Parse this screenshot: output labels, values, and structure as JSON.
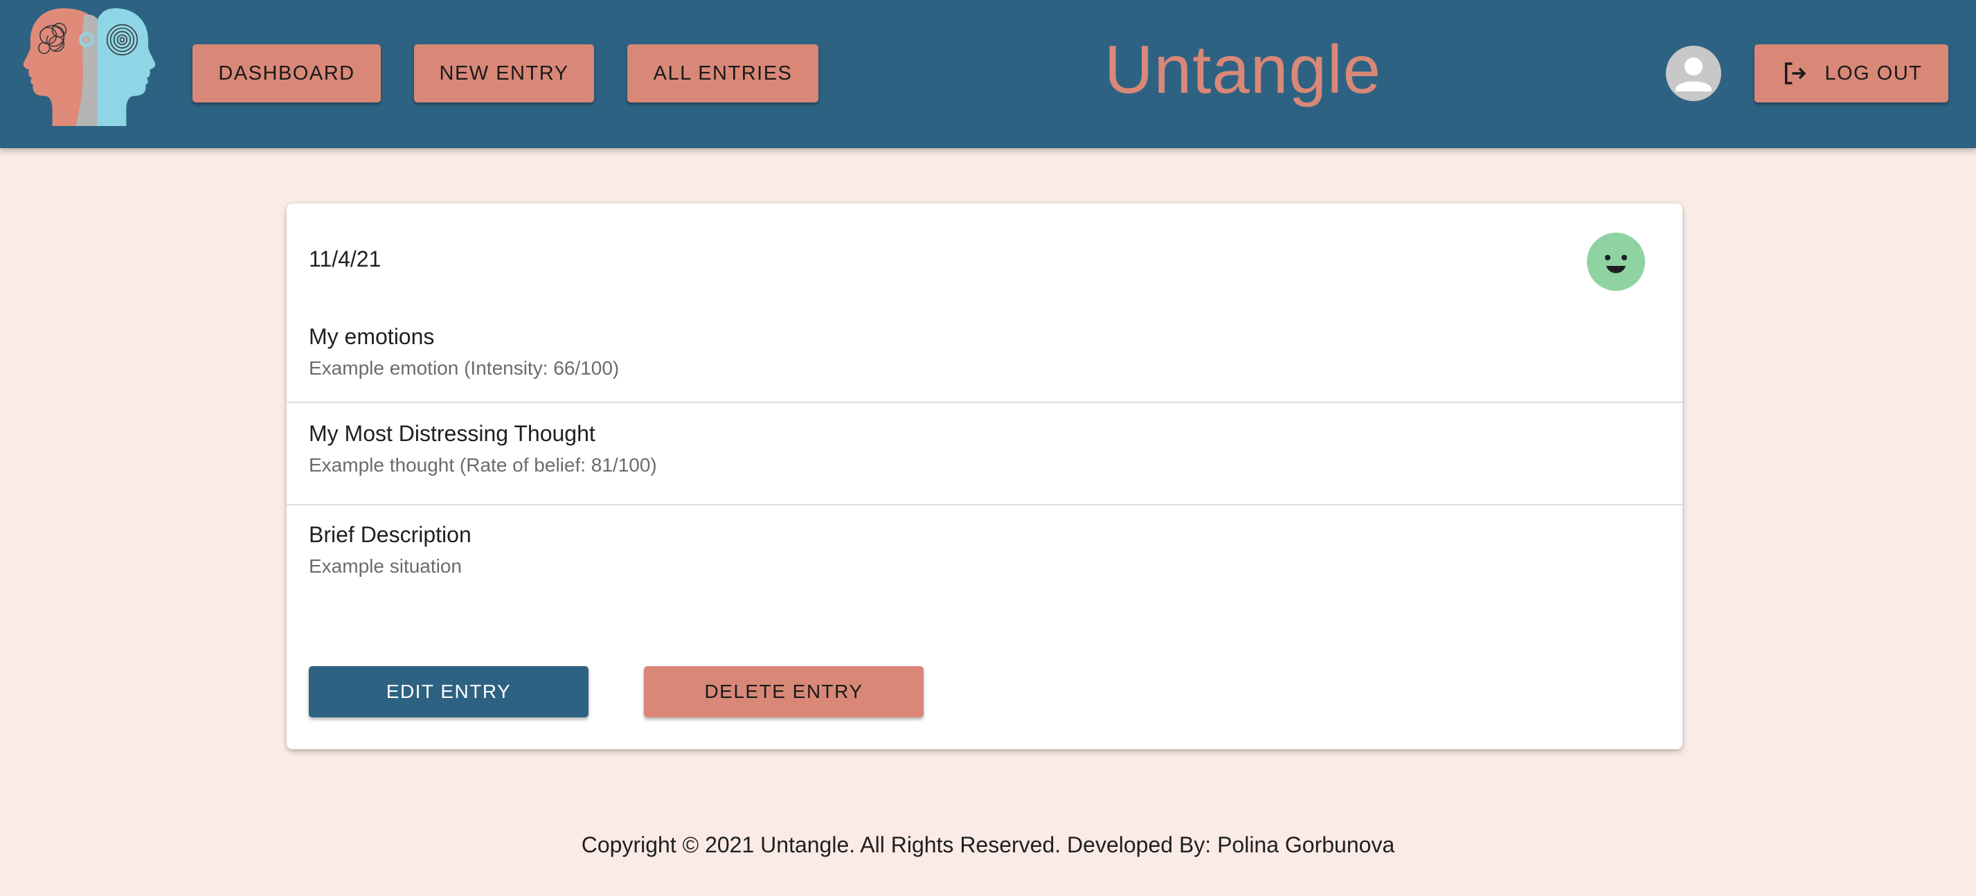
{
  "header": {
    "logo_icon": "two-heads-logo-icon",
    "nav": {
      "dashboard": "DASHBOARD",
      "new_entry": "NEW ENTRY",
      "all_entries": "ALL ENTRIES"
    },
    "title": "Untangle",
    "avatar_icon": "user-avatar-icon",
    "logout_label": "LOG OUT",
    "logout_icon": "logout-icon"
  },
  "entry": {
    "date": "11/4/21",
    "mood_icon": "smiley-face-icon",
    "sections": [
      {
        "title": "My emotions",
        "body": "Example emotion (Intensity: 66/100)"
      },
      {
        "title": "My Most Distressing Thought",
        "body": "Example thought (Rate of belief: 81/100)"
      },
      {
        "title": "Brief Description",
        "body": "Example situation"
      }
    ],
    "edit_label": "EDIT ENTRY",
    "delete_label": "DELETE ENTRY"
  },
  "footer": {
    "text": "Copyright © 2021 Untangle. All Rights Reserved. Developed By: Polina Gorbunova"
  },
  "colors": {
    "header_bg": "#2e6282",
    "accent": "#d98878",
    "page_bg": "#fbebe7",
    "mood_green": "#8fd3a2"
  }
}
